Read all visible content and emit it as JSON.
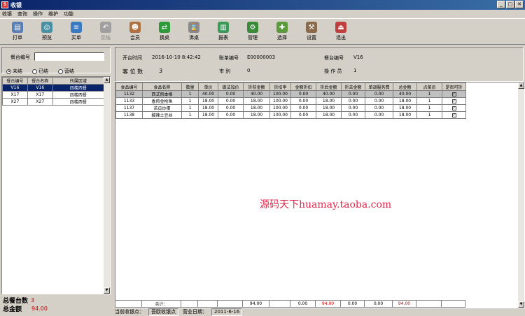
{
  "window": {
    "title": "收银",
    "app_icon": "app-icon",
    "min": "_",
    "max": "□",
    "close": "✕"
  },
  "menu": [
    "收银",
    "查询",
    "操作",
    "维护",
    "功能"
  ],
  "toolbar": [
    {
      "label": "打单",
      "icon": "print-icon",
      "color": "#5a7fb5",
      "glyph": "▤",
      "enabled": true
    },
    {
      "label": "预览",
      "icon": "preview-icon",
      "color": "#4a90a4",
      "glyph": "◎",
      "enabled": true
    },
    {
      "label": "买单",
      "icon": "bill-icon",
      "color": "#3a7ac0",
      "glyph": "≡",
      "enabled": true
    },
    {
      "label": "反结",
      "icon": "reverse-icon",
      "color": "#a0a0a0",
      "glyph": "↶",
      "enabled": false
    },
    {
      "label": "会员",
      "icon": "member-icon",
      "color": "#b07040",
      "glyph": "☻",
      "enabled": true
    },
    {
      "label": "换桌",
      "icon": "swap-icon",
      "color": "#2e9a3a",
      "glyph": "⇄",
      "enabled": true
    },
    {
      "label": "沸桌",
      "icon": "hourglass-icon",
      "color": "#8a8a8a",
      "glyph": "⌛",
      "enabled": true
    },
    {
      "label": "报表",
      "icon": "report-icon",
      "color": "#3a9a5a",
      "glyph": "▥",
      "enabled": true
    },
    {
      "label": "管理",
      "icon": "gear-icon",
      "color": "#3a8a3a",
      "glyph": "⚙",
      "enabled": true
    },
    {
      "label": "选择",
      "icon": "select-icon",
      "color": "#5a9a3a",
      "glyph": "✚",
      "enabled": true
    },
    {
      "label": "设置",
      "icon": "settings-icon",
      "color": "#8a6a4a",
      "glyph": "⚒",
      "enabled": true
    },
    {
      "label": "退出",
      "icon": "exit-icon",
      "color": "#c04040",
      "glyph": "⏏",
      "enabled": true
    }
  ],
  "left": {
    "search_label": "餐台编号",
    "search_value": "",
    "radios": [
      {
        "label": "未结",
        "selected": true
      },
      {
        "label": "已结",
        "selected": false
      },
      {
        "label": "营结",
        "selected": false
      }
    ],
    "table_headers": [
      "餐台编号",
      "餐台名称",
      "所属区域"
    ],
    "table_rows": [
      {
        "cells": [
          "V16",
          "V16",
          "四楼西餐"
        ],
        "selected": true
      },
      {
        "cells": [
          "X17",
          "X17",
          "四楼西餐"
        ],
        "selected": false
      },
      {
        "cells": [
          "X27",
          "X27",
          "四楼西餐"
        ],
        "selected": false
      }
    ],
    "total_tables_label": "总餐台数",
    "total_tables_value": "3",
    "total_amount_label": "总金额",
    "total_amount_value": "94.00"
  },
  "info": {
    "open_time_label": "开台时间",
    "open_time": "2016-10-10 8:42:42",
    "bill_no_label": "账单编号",
    "bill_no": "E00000003",
    "table_no_label": "餐台编号",
    "table_no": "V16",
    "seats_label": "客 位 数",
    "seats": "3",
    "market_label": "市    别",
    "market": "0",
    "operator_label": "操 作 员",
    "operator": "1"
  },
  "grid": {
    "headers": [
      "食品编号",
      "食品名称",
      "数量",
      "单价",
      "做法加价",
      "折前金额",
      "折扣率",
      "金额折扣",
      "折后金额",
      "折去金额",
      "单调服务费",
      "总金额",
      "点菜员",
      "是否可折"
    ],
    "rows": [
      {
        "cells": [
          "1132",
          "西式煎本格",
          "1",
          "40.00",
          "0.00",
          "40.00",
          "100.00",
          "0.00",
          "40.00",
          "0.00",
          "0.00",
          "40.00",
          "1"
        ],
        "check": "✓",
        "selected": true
      },
      {
        "cells": [
          "1133",
          "香煎金枪鱼",
          "1",
          "18.00",
          "0.00",
          "18.00",
          "100.00",
          "0.00",
          "18.00",
          "0.00",
          "0.00",
          "18.00",
          "1"
        ],
        "check": "✓",
        "selected": false
      },
      {
        "cells": [
          "1137",
          "苦瓜炒蛋",
          "1",
          "18.00",
          "0.00",
          "18.00",
          "100.00",
          "0.00",
          "18.00",
          "0.00",
          "0.00",
          "18.00",
          "1"
        ],
        "check": "✓",
        "selected": false
      },
      {
        "cells": [
          "1138",
          "酸辣土豆丝",
          "1",
          "18.00",
          "0.00",
          "18.00",
          "100.00",
          "0.00",
          "18.00",
          "0.00",
          "0.00",
          "18.00",
          "1"
        ],
        "check": "✓",
        "selected": false
      }
    ],
    "total_label": "合计：",
    "total_prediscount": "94.00",
    "total_discount": "0.00",
    "total_after": "94.00",
    "total_cut": "0.00",
    "total_service": "0.00",
    "total_amount": "94.00"
  },
  "watermark": "源码天下huamay.taoba.com",
  "status": {
    "point_label": "当前收银点：",
    "point": "吾欧收银点",
    "date_label": "营业日期：",
    "date": "2011-6-16"
  }
}
